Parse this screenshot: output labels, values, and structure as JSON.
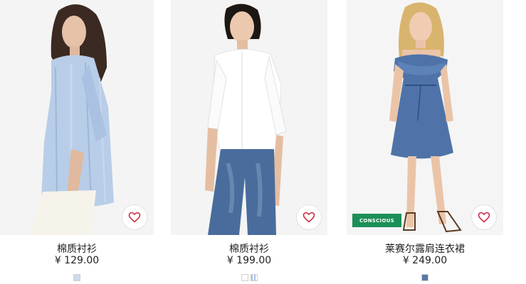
{
  "products": [
    {
      "name": "棉质衬衫",
      "price": "¥ 129.00",
      "badge": "",
      "swatches": [
        {
          "color": "#cdd9ea",
          "pattern": "solid"
        }
      ],
      "icons": {
        "wishlist": "heart-outline-icon"
      }
    },
    {
      "name": "棉质衬衫",
      "price": "¥ 199.00",
      "badge": "",
      "swatches": [
        {
          "color": "#ffffff",
          "pattern": "solid"
        },
        {
          "color": "#a9bfe0",
          "pattern": "striped"
        }
      ],
      "icons": {
        "wishlist": "heart-outline-icon"
      }
    },
    {
      "name": "莱赛尔露肩连衣裙",
      "price": "¥ 249.00",
      "badge": "CONSCIOUS",
      "swatches": [
        {
          "color": "#5a78a8",
          "pattern": "solid"
        }
      ],
      "icons": {
        "wishlist": "heart-outline-icon"
      }
    }
  ],
  "colors": {
    "heart": "#c7263e",
    "conscious_badge": "#1b8f57",
    "photo_bg": "#f3f3f3"
  }
}
